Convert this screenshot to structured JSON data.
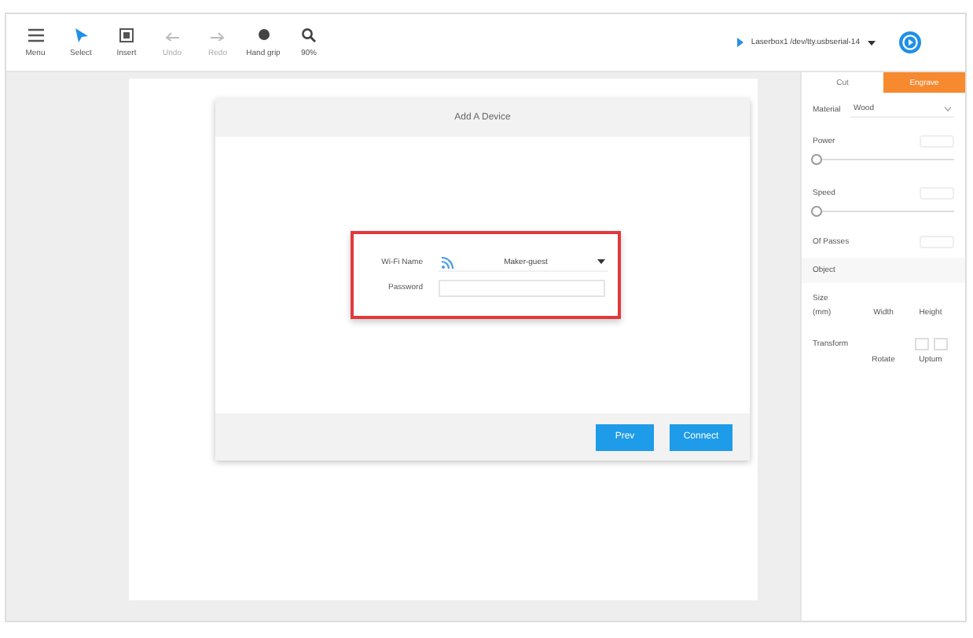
{
  "toolbar": {
    "tools": [
      {
        "kind": "menu",
        "label": "Menu",
        "disabled": false
      },
      {
        "kind": "select",
        "label": "Select",
        "disabled": false
      },
      {
        "kind": "insert",
        "label": "Insert",
        "disabled": false
      },
      {
        "kind": "undo",
        "label": "Undo",
        "disabled": true
      },
      {
        "kind": "redo",
        "label": "Redo",
        "disabled": true
      },
      {
        "kind": "hand",
        "label": "Hand grip",
        "disabled": false
      },
      {
        "kind": "zoom",
        "label": "90%",
        "disabled": false
      }
    ],
    "device": {
      "name": "Laserbox1 /dev/tty.usbserial-14"
    }
  },
  "panel": {
    "tabs": [
      {
        "label": "Cut",
        "selected": false
      },
      {
        "label": "Engrave",
        "selected": true
      }
    ],
    "material": {
      "label": "Material",
      "value": "Wood"
    },
    "power": {
      "label": "Power",
      "level": 0
    },
    "speed": {
      "label": "Speed",
      "level": 0
    },
    "passes": {
      "label": "Of Passes"
    },
    "object": {
      "title": "Object"
    },
    "size": {
      "label": "Size",
      "unit": "(mm)",
      "width_label": "Width",
      "height_label": "Height"
    },
    "transform": {
      "label": "Transform",
      "rotate_label": "Rotate",
      "flip_label": "Uptum"
    }
  },
  "dialog": {
    "title": "Add A Device",
    "wifi_name": {
      "label": "Wi-Fi Name",
      "value": "Maker-guest"
    },
    "password": {
      "label": "Password"
    },
    "buttons": [
      "Prev",
      "Connect"
    ]
  }
}
